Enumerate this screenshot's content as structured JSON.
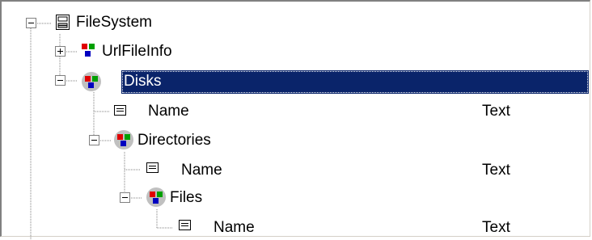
{
  "tree": {
    "nodes": [
      {
        "label": "FileSystem",
        "icon": "database-table-icon",
        "expander": "minus"
      },
      {
        "label": "UrlFileInfo",
        "icon": "entity-icon",
        "expander": "plus"
      },
      {
        "label": "Disks",
        "icon": "entity-collection-icon",
        "expander": "minus",
        "selected": true
      },
      {
        "label": "Name",
        "type": "Text",
        "icon": "field-icon"
      },
      {
        "label": "Directories",
        "icon": "entity-collection-icon",
        "expander": "minus"
      },
      {
        "label": "Name",
        "type": "Text",
        "icon": "field-icon"
      },
      {
        "label": "Files",
        "icon": "entity-collection-icon",
        "expander": "minus"
      },
      {
        "label": "Name",
        "type": "Text",
        "icon": "field-icon"
      }
    ]
  },
  "colors": {
    "selection": "#0a246a",
    "tree_line": "#808080"
  }
}
